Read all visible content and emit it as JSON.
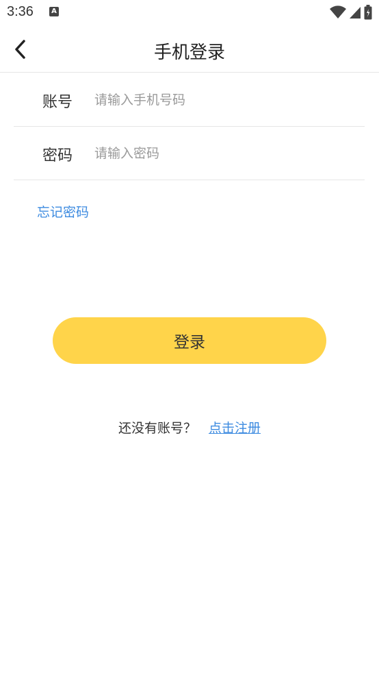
{
  "status_bar": {
    "time": "3:36",
    "notification_icon_letter": "A",
    "icons": [
      "wifi-icon",
      "signal-icon",
      "battery-icon"
    ]
  },
  "header": {
    "title": "手机登录",
    "back_icon": "chevron-left-icon"
  },
  "form": {
    "account": {
      "label": "账号",
      "placeholder": "请输入手机号码",
      "value": ""
    },
    "password": {
      "label": "密码",
      "placeholder": "请输入密码",
      "value": ""
    },
    "forgot_password": "忘记密码"
  },
  "actions": {
    "login_label": "登录"
  },
  "register": {
    "prompt": "还没有账号？",
    "link": "点击注册"
  },
  "colors": {
    "accent_yellow": "#ffd44a",
    "link_blue": "#3d8be0",
    "divider": "#e6e6e6"
  }
}
